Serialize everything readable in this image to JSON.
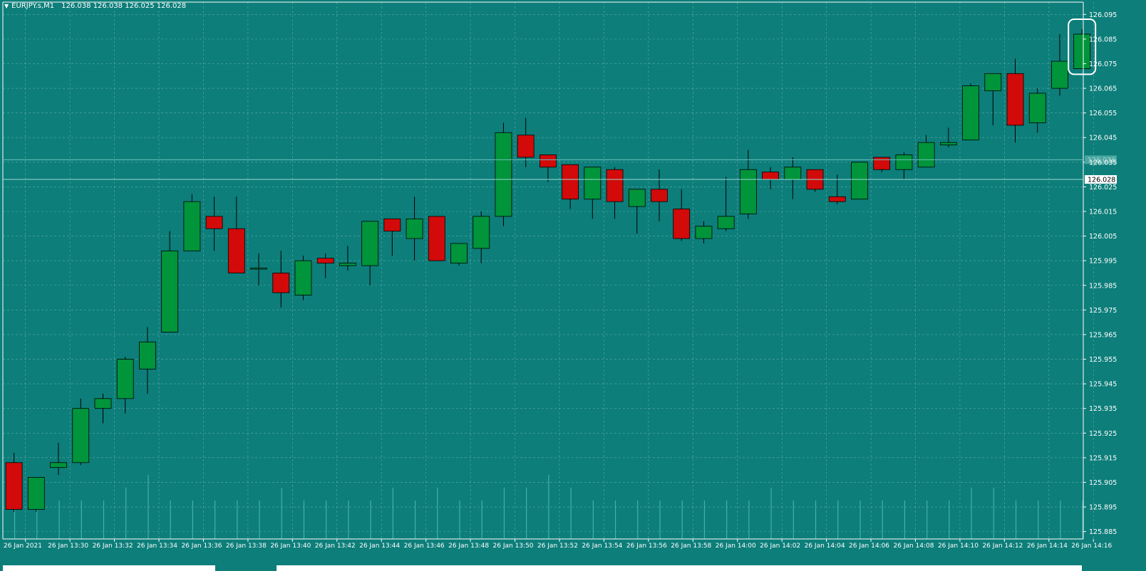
{
  "header": {
    "menu_icon": "triangle-down-icon",
    "symbol": "EURJPY.s,M1",
    "ohlc": "126.038 126.038 126.025 126.028"
  },
  "colors": {
    "background": "#0d7e7a",
    "bull": "#00943b",
    "bear": "#d20a0a",
    "grid": "#9fd0cd",
    "axis": "#ffffff",
    "text": "#ffffff"
  },
  "chart_data": {
    "type": "candlestick",
    "title": "EURJPY.s,M1",
    "grid": true,
    "y_scale": "linear",
    "ylim": [
      125.882,
      126.1
    ],
    "y_ticks": [
      "126.095",
      "126.085",
      "126.075",
      "126.065",
      "126.055",
      "126.045",
      "126.035",
      "126.025",
      "126.015",
      "126.005",
      "125.995",
      "125.985",
      "125.975",
      "125.965",
      "125.955",
      "125.945",
      "125.935",
      "125.925",
      "125.915",
      "125.905",
      "125.895",
      "125.885"
    ],
    "x_ticks": [
      "26 Jan 2021",
      "26 Jan 13:30",
      "26 Jan 13:32",
      "26 Jan 13:34",
      "26 Jan 13:36",
      "26 Jan 13:38",
      "26 Jan 13:40",
      "26 Jan 13:42",
      "26 Jan 13:44",
      "26 Jan 13:46",
      "26 Jan 13:48",
      "26 Jan 13:50",
      "26 Jan 13:52",
      "26 Jan 13:54",
      "26 Jan 13:56",
      "26 Jan 13:58",
      "26 Jan 14:00",
      "26 Jan 14:02",
      "26 Jan 14:04",
      "26 Jan 14:06",
      "26 Jan 14:08",
      "26 Jan 14:10",
      "26 Jan 14:12",
      "26 Jan 14:14",
      "26 Jan 14:16"
    ],
    "ask_price_label": "126.036",
    "bid_price_label": "126.028",
    "highlight": "last candle circled",
    "candles": [
      {
        "o": 125.913,
        "h": 125.917,
        "l": 125.893,
        "c": 125.894
      },
      {
        "o": 125.894,
        "h": 125.907,
        "l": 125.893,
        "c": 125.907
      },
      {
        "o": 125.911,
        "h": 125.921,
        "l": 125.908,
        "c": 125.913
      },
      {
        "o": 125.913,
        "h": 125.939,
        "l": 125.912,
        "c": 125.935
      },
      {
        "o": 125.935,
        "h": 125.941,
        "l": 125.929,
        "c": 125.939
      },
      {
        "o": 125.939,
        "h": 125.956,
        "l": 125.933,
        "c": 125.955
      },
      {
        "o": 125.951,
        "h": 125.968,
        "l": 125.941,
        "c": 125.962
      },
      {
        "o": 125.966,
        "h": 126.007,
        "l": 125.966,
        "c": 125.999
      },
      {
        "o": 125.999,
        "h": 126.022,
        "l": 125.999,
        "c": 126.019
      },
      {
        "o": 126.013,
        "h": 126.021,
        "l": 125.999,
        "c": 126.008
      },
      {
        "o": 126.008,
        "h": 126.021,
        "l": 125.994,
        "c": 125.99
      },
      {
        "o": 125.992,
        "h": 125.998,
        "l": 125.985,
        "c": 125.992
      },
      {
        "o": 125.99,
        "h": 125.999,
        "l": 125.976,
        "c": 125.982
      },
      {
        "o": 125.981,
        "h": 125.997,
        "l": 125.979,
        "c": 125.995
      },
      {
        "o": 125.996,
        "h": 125.998,
        "l": 125.988,
        "c": 125.994
      },
      {
        "o": 125.993,
        "h": 126.001,
        "l": 125.991,
        "c": 125.994
      },
      {
        "o": 125.993,
        "h": 126.011,
        "l": 125.985,
        "c": 126.011
      },
      {
        "o": 126.012,
        "h": 126.011,
        "l": 125.997,
        "c": 126.007
      },
      {
        "o": 126.004,
        "h": 126.021,
        "l": 125.995,
        "c": 126.012
      },
      {
        "o": 126.013,
        "h": 126.012,
        "l": 125.996,
        "c": 125.995
      },
      {
        "o": 125.994,
        "h": 126.001,
        "l": 125.993,
        "c": 126.002
      },
      {
        "o": 126.0,
        "h": 126.015,
        "l": 125.994,
        "c": 126.013
      },
      {
        "o": 126.013,
        "h": 126.051,
        "l": 126.009,
        "c": 126.047
      },
      {
        "o": 126.046,
        "h": 126.053,
        "l": 126.033,
        "c": 126.037
      },
      {
        "o": 126.038,
        "h": 126.038,
        "l": 126.027,
        "c": 126.033
      },
      {
        "o": 126.034,
        "h": 126.034,
        "l": 126.016,
        "c": 126.02
      },
      {
        "o": 126.02,
        "h": 126.032,
        "l": 126.012,
        "c": 126.033
      },
      {
        "o": 126.032,
        "h": 126.033,
        "l": 126.012,
        "c": 126.019
      },
      {
        "o": 126.017,
        "h": 126.024,
        "l": 126.006,
        "c": 126.024
      },
      {
        "o": 126.024,
        "h": 126.032,
        "l": 126.011,
        "c": 126.019
      },
      {
        "o": 126.016,
        "h": 126.024,
        "l": 126.003,
        "c": 126.004
      },
      {
        "o": 126.004,
        "h": 126.011,
        "l": 126.002,
        "c": 126.009
      },
      {
        "o": 126.008,
        "h": 126.029,
        "l": 126.007,
        "c": 126.013
      },
      {
        "o": 126.014,
        "h": 126.04,
        "l": 126.012,
        "c": 126.032
      },
      {
        "o": 126.031,
        "h": 126.033,
        "l": 126.024,
        "c": 126.028
      },
      {
        "o": 126.028,
        "h": 126.037,
        "l": 126.02,
        "c": 126.033
      },
      {
        "o": 126.032,
        "h": 126.032,
        "l": 126.023,
        "c": 126.024
      },
      {
        "o": 126.021,
        "h": 126.03,
        "l": 126.018,
        "c": 126.019
      },
      {
        "o": 126.02,
        "h": 126.035,
        "l": 126.02,
        "c": 126.035
      },
      {
        "o": 126.037,
        "h": 126.037,
        "l": 126.031,
        "c": 126.032
      },
      {
        "o": 126.032,
        "h": 126.039,
        "l": 126.028,
        "c": 126.038
      },
      {
        "o": 126.033,
        "h": 126.046,
        "l": 126.033,
        "c": 126.043
      },
      {
        "o": 126.042,
        "h": 126.049,
        "l": 126.041,
        "c": 126.043
      },
      {
        "o": 126.044,
        "h": 126.067,
        "l": 126.044,
        "c": 126.066
      },
      {
        "o": 126.064,
        "h": 126.071,
        "l": 126.05,
        "c": 126.071
      },
      {
        "o": 126.071,
        "h": 126.077,
        "l": 126.043,
        "c": 126.05
      },
      {
        "o": 126.051,
        "h": 126.065,
        "l": 126.047,
        "c": 126.063
      },
      {
        "o": 126.065,
        "h": 126.087,
        "l": 126.062,
        "c": 126.076
      },
      {
        "o": 126.073,
        "h": 126.089,
        "l": 126.073,
        "c": 126.087
      }
    ],
    "volume_ticks": [
      4,
      3,
      3,
      3,
      3,
      4,
      5,
      3,
      3,
      3,
      3,
      3,
      4,
      3,
      3,
      3,
      3,
      4,
      3,
      4,
      3,
      3,
      4,
      4,
      5,
      4,
      3,
      3,
      3,
      3,
      3,
      3,
      3,
      3,
      4,
      3,
      3,
      3,
      3,
      3,
      3,
      3,
      3,
      4,
      4,
      3,
      3,
      3,
      3
    ]
  }
}
